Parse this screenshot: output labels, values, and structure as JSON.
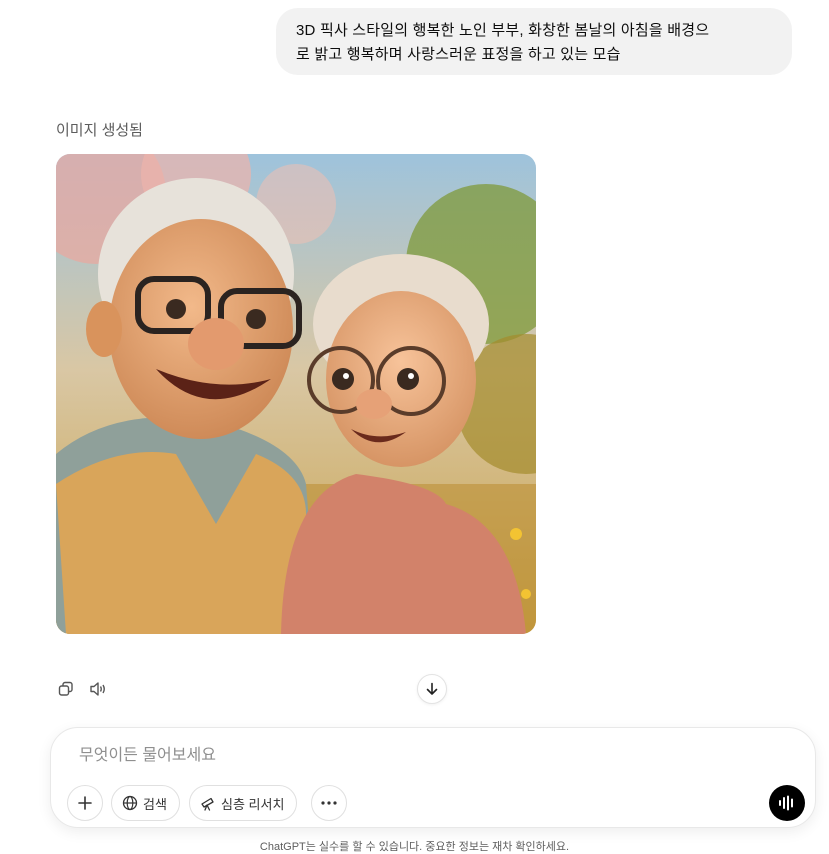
{
  "user_message": {
    "line1": "3D 픽사 스타일의 행복한 노인 부부, 화창한 봄날의 아침을 배경으",
    "line2": "로 밝고 행복하며 사랑스러운 표정을 하고 있는 모습"
  },
  "assistant": {
    "status": "이미지 생성됨",
    "image_subject": "elderly-couple-pixar-portrait"
  },
  "message_actions": {
    "copy_icon": "copy-icon",
    "read_aloud_icon": "speaker-icon"
  },
  "composer": {
    "placeholder": "무엇이든 물어보세요",
    "value": "",
    "tools": {
      "add_icon": "plus-icon",
      "search_label": "검색",
      "deep_research_label": "심층 리서치",
      "more_icon": "ellipsis-icon"
    },
    "voice_icon": "voice-waveform-icon"
  },
  "footer": {
    "disclaimer": "ChatGPT는 실수를 할 수 있습니다. 중요한 정보는 재차 확인하세요."
  },
  "colors": {
    "accent": "#000000",
    "bubble": "#f2f2f2"
  }
}
